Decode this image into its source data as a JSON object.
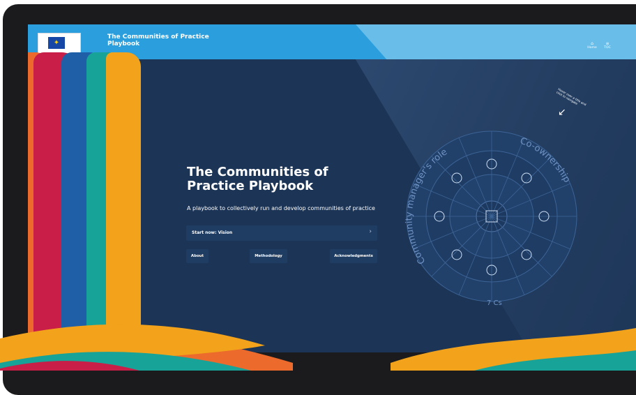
{
  "header": {
    "logo_text": "European Commission",
    "site_title": "The Communities of Practice Playbook",
    "nav": [
      {
        "label": "Home",
        "icon": "home-icon"
      },
      {
        "label": "TOC",
        "icon": "menu-icon"
      }
    ]
  },
  "hero": {
    "title_line1": "The Communities of",
    "title_line2": "Practice Playbook",
    "subtitle": "A playbook to collectively run and develop communities of practice",
    "start_button": "Start now: Vision",
    "buttons": [
      "About",
      "Methodology",
      "Acknowledgments"
    ]
  },
  "wheel": {
    "hint": "Hover over a title and click to navigate",
    "outer_left_label": "Community manager's role",
    "outer_right_label": "Co-ownership",
    "bottom_label": "7 Cs"
  },
  "colors": {
    "screen_bg": "#1c3557",
    "topbar": "#2b9fdd",
    "button_bg": "#1f3d63",
    "wave_orange": "#ec6a2c",
    "wave_red": "#c81e47",
    "wave_blue": "#1f5fa8",
    "wave_teal": "#17a398",
    "wave_yellow": "#f2a31b"
  }
}
